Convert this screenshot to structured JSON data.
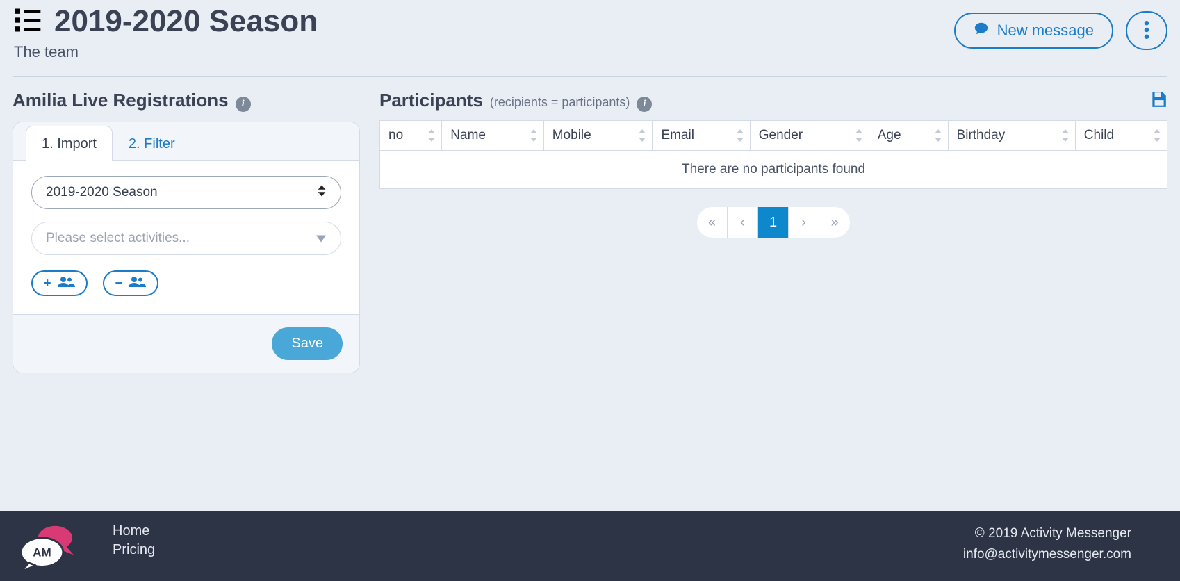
{
  "header": {
    "title": "2019-2020 Season",
    "subtitle": "The team",
    "new_message_label": "New message"
  },
  "left": {
    "section_title": "Amilia Live Registrations",
    "tabs": {
      "import": "1. Import",
      "filter": "2. Filter"
    },
    "season_selected": "2019-2020 Season",
    "activities_placeholder": "Please select activities...",
    "save_label": "Save"
  },
  "right": {
    "section_title": "Participants",
    "hint": "(recipients = participants)",
    "columns": [
      "no",
      "Name",
      "Mobile",
      "Email",
      "Gender",
      "Age",
      "Birthday",
      "Child"
    ],
    "empty_message": "There are no participants found",
    "pager": {
      "first": "«",
      "prev": "‹",
      "current": "1",
      "next": "›",
      "last": "»"
    }
  },
  "footer": {
    "links": {
      "home": "Home",
      "pricing": "Pricing"
    },
    "copyright": "© 2019 Activity Messenger",
    "email": "info@activitymessenger.com"
  }
}
